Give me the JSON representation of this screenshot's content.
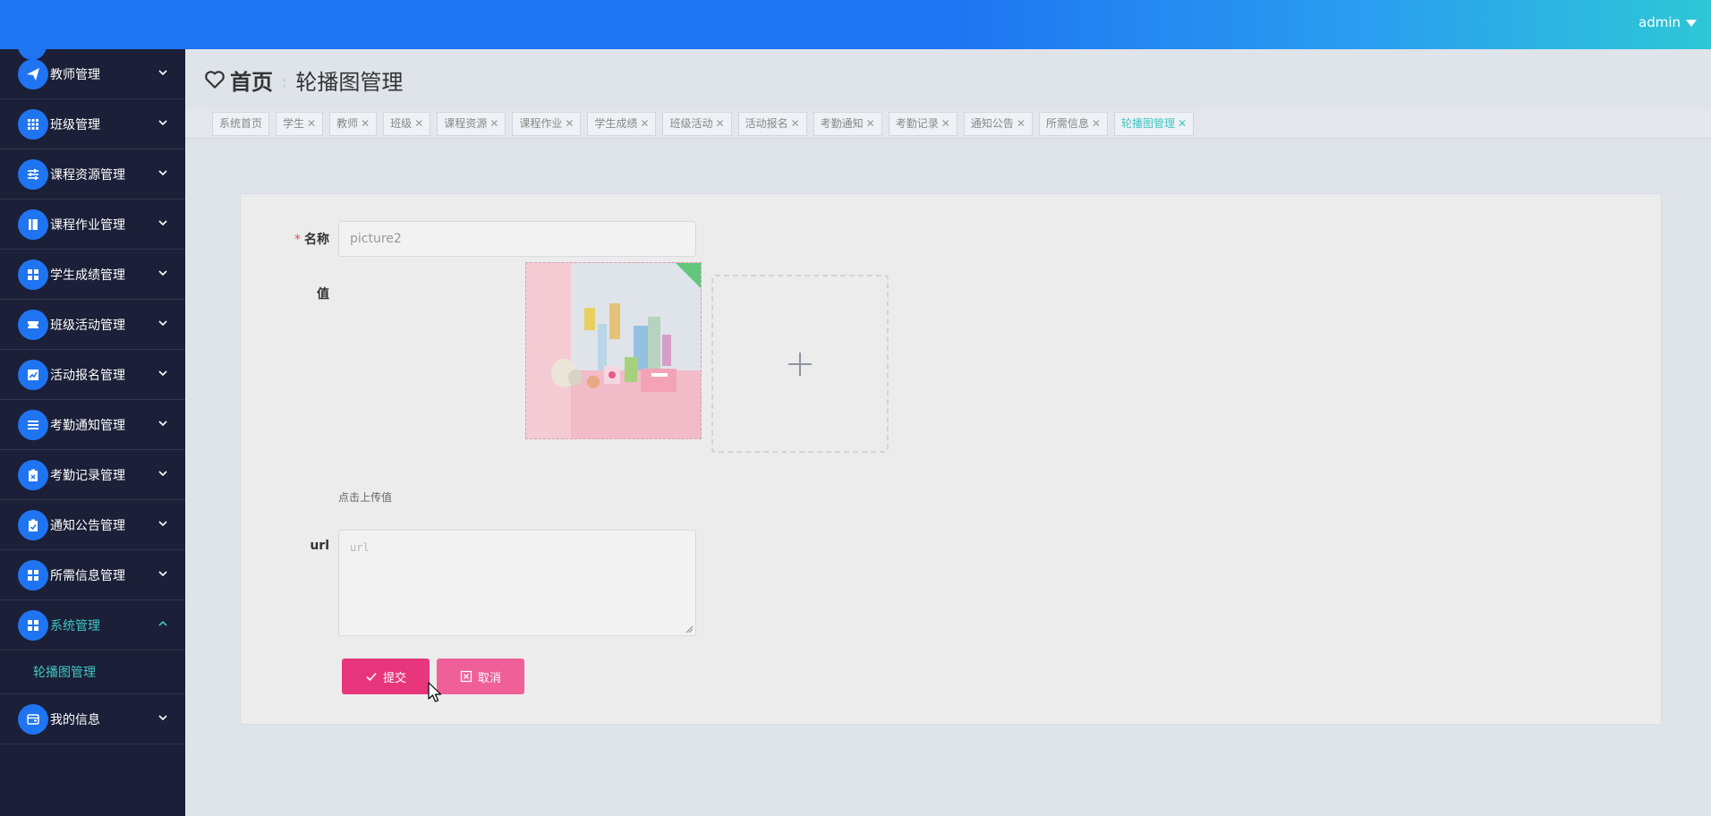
{
  "header": {
    "user_label": "admin",
    "caret_icon": "caret-down-icon"
  },
  "sidebar": {
    "items": [
      {
        "label": "教师管理",
        "icon": "send-icon"
      },
      {
        "label": "班级管理",
        "icon": "grid-icon"
      },
      {
        "label": "课程资源管理",
        "icon": "sliders-icon"
      },
      {
        "label": "课程作业管理",
        "icon": "book-icon"
      },
      {
        "label": "学生成绩管理",
        "icon": "apps-icon"
      },
      {
        "label": "班级活动管理",
        "icon": "ticket-icon"
      },
      {
        "label": "活动报名管理",
        "icon": "chart-icon"
      },
      {
        "label": "考勤通知管理",
        "icon": "list-icon"
      },
      {
        "label": "考勤记录管理",
        "icon": "clipboard-icon"
      },
      {
        "label": "通知公告管理",
        "icon": "clipboard-check-icon"
      },
      {
        "label": "所需信息管理",
        "icon": "apps-icon"
      },
      {
        "label": "系统管理",
        "icon": "apps-icon",
        "active": true
      },
      {
        "label": "我的信息",
        "icon": "wallet-icon"
      }
    ],
    "submenu": {
      "label": "轮播图管理"
    }
  },
  "breadcrumb": {
    "home_label": "首页",
    "separator": ":",
    "current_label": "轮播图管理"
  },
  "tabs": [
    {
      "label": "系统首页",
      "closable": false
    },
    {
      "label": "学生",
      "closable": true
    },
    {
      "label": "教师",
      "closable": true
    },
    {
      "label": "班级",
      "closable": true
    },
    {
      "label": "课程资源",
      "closable": true
    },
    {
      "label": "课程作业",
      "closable": true
    },
    {
      "label": "学生成绩",
      "closable": true
    },
    {
      "label": "班级活动",
      "closable": true
    },
    {
      "label": "活动报名",
      "closable": true
    },
    {
      "label": "考勤通知",
      "closable": true
    },
    {
      "label": "考勤记录",
      "closable": true
    },
    {
      "label": "通知公告",
      "closable": true
    },
    {
      "label": "所需信息",
      "closable": true
    },
    {
      "label": "轮播图管理",
      "closable": true,
      "active": true
    }
  ],
  "form": {
    "name_label": "名称",
    "name_required_mark": "*",
    "name_value": "picture2",
    "value_label": "值",
    "upload_hint": "点击上传值",
    "url_label": "url",
    "url_placeholder": "url",
    "submit_label": "提交",
    "cancel_label": "取消"
  },
  "colors": {
    "header_blue": "#1f74f2",
    "header_teal": "#2ec7d6",
    "sidebar_bg": "#1b1f37",
    "accent_teal": "#3ec7c2",
    "submit_pink": "#e8367d",
    "cancel_pink": "#ef5f98"
  }
}
